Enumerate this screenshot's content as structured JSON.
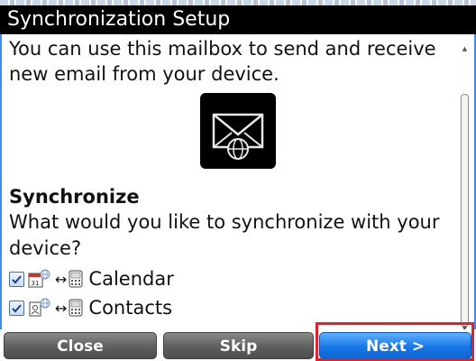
{
  "window": {
    "title": "Synchronization Setup"
  },
  "intro": {
    "text": "You can use this mailbox to send and receive new email from your device."
  },
  "icons": {
    "mailbox": "envelope-globe-icon",
    "calendar": "calendar-icon",
    "contacts": "contacts-icon",
    "sync": "sync-arrows-icon",
    "device": "device-icon",
    "checkbox": "checkmark-icon"
  },
  "synchronize": {
    "heading": "Synchronize",
    "question": "What would you like to synchronize with your device?",
    "items": [
      {
        "label": "Calendar",
        "checked": true
      },
      {
        "label": "Contacts",
        "checked": true
      }
    ]
  },
  "buttons": {
    "close": "Close",
    "skip": "Skip",
    "next": "Next >"
  },
  "colors": {
    "titlebar": "#000000",
    "accent": "#1877e6",
    "highlight": "#e2202c",
    "frame": "#3a8ee6"
  }
}
